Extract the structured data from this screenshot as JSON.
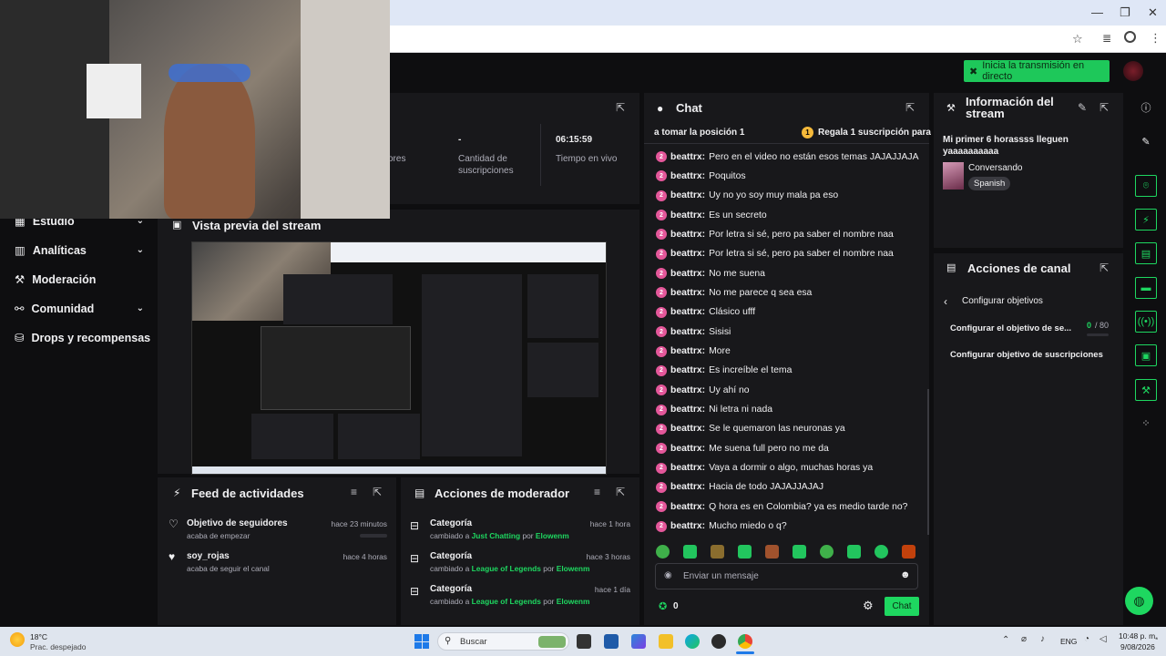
{
  "browser": {
    "win_min": "—",
    "win_max": "❐",
    "win_close": "✕",
    "star_icon": "star-icon"
  },
  "topbar": {
    "golive_label": "Inicia la transmisión en directo"
  },
  "sidebar": {
    "items": [
      {
        "label": "Estudio",
        "icon": "▦",
        "chev": "⌄"
      },
      {
        "label": "Analíticas",
        "icon": "▥",
        "chev": "⌄"
      },
      {
        "label": "Moderación",
        "icon": "⚒",
        "chev": ""
      },
      {
        "label": "Comunidad",
        "icon": "⚯",
        "chev": "⌄"
      },
      {
        "label": "Drops y recompensas",
        "icon": "⛁",
        "chev": ""
      }
    ]
  },
  "stats": {
    "col1": {
      "label": "ores"
    },
    "col2": {
      "value": "-",
      "label": "Cantidad de suscripciones"
    },
    "col3": {
      "value": "06:15:59",
      "label": "Tiempo en vivo"
    }
  },
  "preview": {
    "title": "Vista previa del stream"
  },
  "chat": {
    "title": "Chat",
    "pinned_left": "a tomar la posición 1",
    "pinned_badge": "1",
    "pinned_right": "Regala 1 suscripción para",
    "messages": [
      {
        "user": "beattrx:",
        "text": "Pero en el video no están esos temas JAJAJJAJA"
      },
      {
        "user": "beattrx:",
        "text": "Poquitos"
      },
      {
        "user": "beattrx:",
        "text": "Uy no yo soy muy mala pa eso"
      },
      {
        "user": "beattrx:",
        "text": "Es un secreto"
      },
      {
        "user": "beattrx:",
        "text": "Por letra si sé, pero pa saber el nombre naa"
      },
      {
        "user": "beattrx:",
        "text": "Por letra si sé, pero pa saber el nombre naa"
      },
      {
        "user": "beattrx:",
        "text": "No me suena"
      },
      {
        "user": "beattrx:",
        "text": "No me parece q sea esa"
      },
      {
        "user": "beattrx:",
        "text": "Clásico ufff"
      },
      {
        "user": "beattrx:",
        "text": "Sisisi"
      },
      {
        "user": "beattrx:",
        "text": "More"
      },
      {
        "user": "beattrx:",
        "text": "Es increíble el tema"
      },
      {
        "user": "beattrx:",
        "text": "Uy ahí no"
      },
      {
        "user": "beattrx:",
        "text": "Ni letra ni nada"
      },
      {
        "user": "beattrx:",
        "text": "Se le quemaron las neuronas ya"
      },
      {
        "user": "beattrx:",
        "text": "Me suena full pero no me da"
      },
      {
        "user": "beattrx:",
        "text": "Vaya a dormir o algo, muchas horas ya"
      },
      {
        "user": "beattrx:",
        "text": "Hacia de todo JAJAJJAJAJ"
      },
      {
        "user": "beattrx:",
        "text": "Q hora es en Colombia? ya es medio tarde no?"
      },
      {
        "user": "beattrx:",
        "text": "Mucho miedo o q?"
      }
    ],
    "input_placeholder": "Enviar un mensaje",
    "points": "0",
    "send_label": "Chat"
  },
  "info": {
    "title": "Información del stream",
    "stream_title": "Mi primer 6 horassss lleguen yaaaaaaaaaa",
    "category": "Conversando",
    "language": "Spanish"
  },
  "channel_actions": {
    "title": "Acciones de canal",
    "back_label": "Configurar objetivos",
    "goal1_label": "Configurar el objetivo de se...",
    "goal1_progress": "0",
    "goal1_total": "/ 80",
    "goal2_label": "Configurar objetivo de suscripciones"
  },
  "feed": {
    "title": "Feed de actividades",
    "items": [
      {
        "title": "Objetivo de seguidores",
        "sub": "acaba de empezar",
        "time": "hace 23 minutos"
      },
      {
        "title": "soy_rojas",
        "sub": "acaba de seguir el canal",
        "time": "hace 4 horas"
      }
    ]
  },
  "modactions": {
    "title": "Acciones de moderador",
    "items": [
      {
        "title": "Categoría",
        "pre": "cambiado a",
        "cat": "Just Chatting",
        "por": "por",
        "mod": "Elowenm",
        "time": "hace 1 hora"
      },
      {
        "title": "Categoría",
        "pre": "cambiado a",
        "cat": "League of Legends",
        "por": "por",
        "mod": "Elowenm",
        "time": "hace 3 horas"
      },
      {
        "title": "Categoría",
        "pre": "cambiado a",
        "cat": "League of Legends",
        "por": "por",
        "mod": "Elowenm",
        "time": "hace 1 día"
      }
    ]
  },
  "taskbar": {
    "weather_temp": "18°C",
    "weather_desc": "Prac. despejado",
    "search_label": "Buscar",
    "lang": "ENG",
    "time": "10:48 p. m.",
    "date": "9/08/2026"
  },
  "colors": {
    "accent": "#1ed760",
    "panel": "#18181b",
    "bg": "#0e0e10",
    "badge": "#e4579a"
  }
}
